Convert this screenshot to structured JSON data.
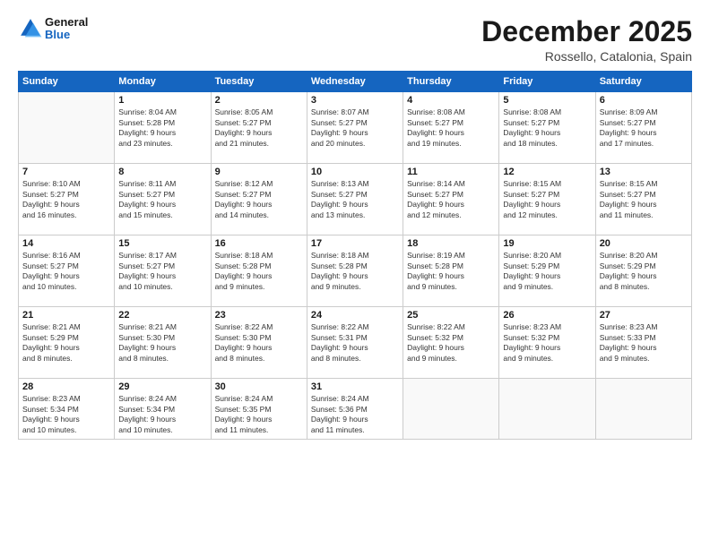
{
  "logo": {
    "line1": "General",
    "line2": "Blue"
  },
  "title": "December 2025",
  "subtitle": "Rossello, Catalonia, Spain",
  "headers": [
    "Sunday",
    "Monday",
    "Tuesday",
    "Wednesday",
    "Thursday",
    "Friday",
    "Saturday"
  ],
  "weeks": [
    [
      {
        "day": "",
        "info": ""
      },
      {
        "day": "1",
        "info": "Sunrise: 8:04 AM\nSunset: 5:28 PM\nDaylight: 9 hours\nand 23 minutes."
      },
      {
        "day": "2",
        "info": "Sunrise: 8:05 AM\nSunset: 5:27 PM\nDaylight: 9 hours\nand 21 minutes."
      },
      {
        "day": "3",
        "info": "Sunrise: 8:07 AM\nSunset: 5:27 PM\nDaylight: 9 hours\nand 20 minutes."
      },
      {
        "day": "4",
        "info": "Sunrise: 8:08 AM\nSunset: 5:27 PM\nDaylight: 9 hours\nand 19 minutes."
      },
      {
        "day": "5",
        "info": "Sunrise: 8:08 AM\nSunset: 5:27 PM\nDaylight: 9 hours\nand 18 minutes."
      },
      {
        "day": "6",
        "info": "Sunrise: 8:09 AM\nSunset: 5:27 PM\nDaylight: 9 hours\nand 17 minutes."
      }
    ],
    [
      {
        "day": "7",
        "info": ""
      },
      {
        "day": "8",
        "info": "Sunrise: 8:11 AM\nSunset: 5:27 PM\nDaylight: 9 hours\nand 15 minutes."
      },
      {
        "day": "9",
        "info": "Sunrise: 8:12 AM\nSunset: 5:27 PM\nDaylight: 9 hours\nand 14 minutes."
      },
      {
        "day": "10",
        "info": "Sunrise: 8:13 AM\nSunset: 5:27 PM\nDaylight: 9 hours\nand 13 minutes."
      },
      {
        "day": "11",
        "info": "Sunrise: 8:14 AM\nSunset: 5:27 PM\nDaylight: 9 hours\nand 12 minutes."
      },
      {
        "day": "12",
        "info": "Sunrise: 8:15 AM\nSunset: 5:27 PM\nDaylight: 9 hours\nand 12 minutes."
      },
      {
        "day": "13",
        "info": "Sunrise: 8:15 AM\nSunset: 5:27 PM\nDaylight: 9 hours\nand 11 minutes."
      }
    ],
    [
      {
        "day": "14",
        "info": "Sunrise: 8:16 AM\nSunset: 5:27 PM\nDaylight: 9 hours\nand 10 minutes."
      },
      {
        "day": "15",
        "info": "Sunrise: 8:17 AM\nSunset: 5:27 PM\nDaylight: 9 hours\nand 10 minutes."
      },
      {
        "day": "16",
        "info": "Sunrise: 8:18 AM\nSunset: 5:28 PM\nDaylight: 9 hours\nand 9 minutes."
      },
      {
        "day": "17",
        "info": "Sunrise: 8:18 AM\nSunset: 5:28 PM\nDaylight: 9 hours\nand 9 minutes."
      },
      {
        "day": "18",
        "info": "Sunrise: 8:19 AM\nSunset: 5:28 PM\nDaylight: 9 hours\nand 9 minutes."
      },
      {
        "day": "19",
        "info": "Sunrise: 8:20 AM\nSunset: 5:29 PM\nDaylight: 9 hours\nand 9 minutes."
      },
      {
        "day": "20",
        "info": "Sunrise: 8:20 AM\nSunset: 5:29 PM\nDaylight: 9 hours\nand 8 minutes."
      }
    ],
    [
      {
        "day": "21",
        "info": "Sunrise: 8:21 AM\nSunset: 5:29 PM\nDaylight: 9 hours\nand 8 minutes."
      },
      {
        "day": "22",
        "info": "Sunrise: 8:21 AM\nSunset: 5:30 PM\nDaylight: 9 hours\nand 8 minutes."
      },
      {
        "day": "23",
        "info": "Sunrise: 8:22 AM\nSunset: 5:30 PM\nDaylight: 9 hours\nand 8 minutes."
      },
      {
        "day": "24",
        "info": "Sunrise: 8:22 AM\nSunset: 5:31 PM\nDaylight: 9 hours\nand 8 minutes."
      },
      {
        "day": "25",
        "info": "Sunrise: 8:22 AM\nSunset: 5:32 PM\nDaylight: 9 hours\nand 9 minutes."
      },
      {
        "day": "26",
        "info": "Sunrise: 8:23 AM\nSunset: 5:32 PM\nDaylight: 9 hours\nand 9 minutes."
      },
      {
        "day": "27",
        "info": "Sunrise: 8:23 AM\nSunset: 5:33 PM\nDaylight: 9 hours\nand 9 minutes."
      }
    ],
    [
      {
        "day": "28",
        "info": "Sunrise: 8:23 AM\nSunset: 5:34 PM\nDaylight: 9 hours\nand 10 minutes."
      },
      {
        "day": "29",
        "info": "Sunrise: 8:24 AM\nSunset: 5:34 PM\nDaylight: 9 hours\nand 10 minutes."
      },
      {
        "day": "30",
        "info": "Sunrise: 8:24 AM\nSunset: 5:35 PM\nDaylight: 9 hours\nand 11 minutes."
      },
      {
        "day": "31",
        "info": "Sunrise: 8:24 AM\nSunset: 5:36 PM\nDaylight: 9 hours\nand 11 minutes."
      },
      {
        "day": "",
        "info": ""
      },
      {
        "day": "",
        "info": ""
      },
      {
        "day": "",
        "info": ""
      }
    ]
  ],
  "week7_sunday_info": "Sunrise: 8:10 AM\nSunset: 5:27 PM\nDaylight: 9 hours\nand 16 minutes."
}
